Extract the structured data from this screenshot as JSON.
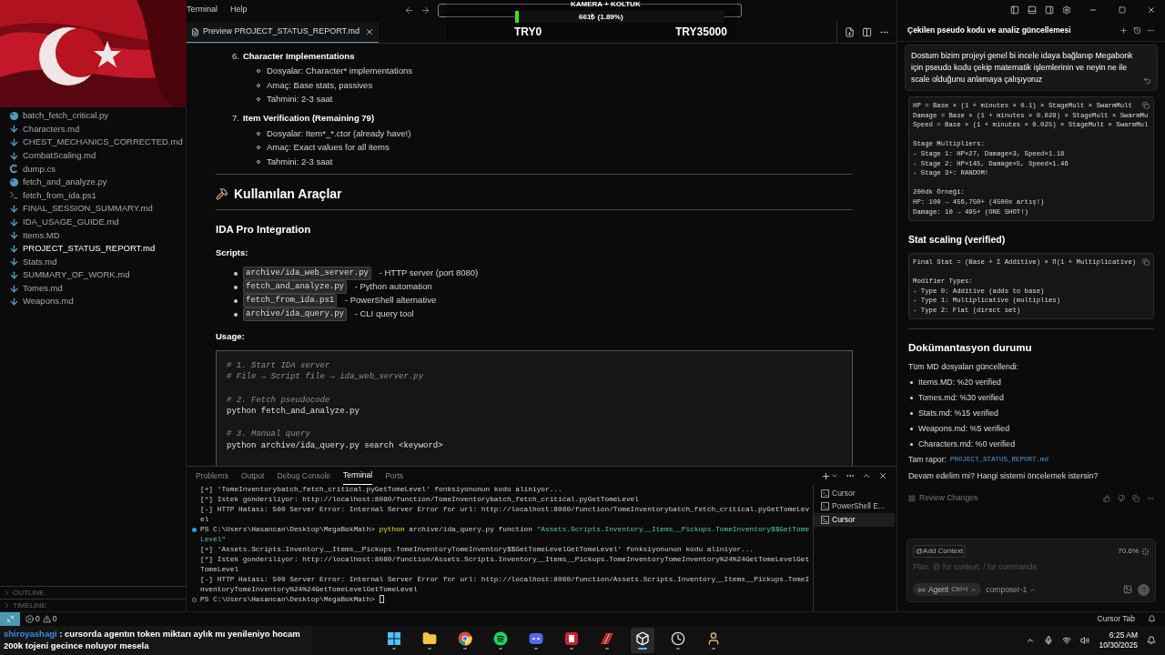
{
  "menu": [
    "Terminal",
    "Help"
  ],
  "stream_goal": {
    "title": "KAMERA + KOLTUK",
    "amount": "661₺ (1.89%)",
    "level": 0.0189,
    "min": "TRY0",
    "max": "TRY35000"
  },
  "explorer": {
    "files": [
      {
        "name": "batch_fetch_critical.py",
        "kind": "python",
        "selected": false
      },
      {
        "name": "Characters.md",
        "kind": "markdown",
        "selected": false
      },
      {
        "name": "CHEST_MECHANICS_CORRECTED.md",
        "kind": "markdown",
        "selected": false
      },
      {
        "name": "CombatScaling.md",
        "kind": "markdown",
        "selected": false
      },
      {
        "name": "dump.cs",
        "kind": "csharp",
        "selected": false
      },
      {
        "name": "fetch_and_analyze.py",
        "kind": "python",
        "selected": false
      },
      {
        "name": "fetch_from_ida.ps1",
        "kind": "powershell",
        "selected": false
      },
      {
        "name": "FINAL_SESSION_SUMMARY.md",
        "kind": "markdown",
        "selected": false
      },
      {
        "name": "IDA_USAGE_GUIDE.md",
        "kind": "markdown",
        "selected": false
      },
      {
        "name": "Items.MD",
        "kind": "markdown",
        "selected": false
      },
      {
        "name": "PROJECT_STATUS_REPORT.md",
        "kind": "markdown",
        "selected": true
      },
      {
        "name": "Stats.md",
        "kind": "markdown",
        "selected": false
      },
      {
        "name": "SUMMARY_OF_WORK.md",
        "kind": "markdown",
        "selected": false
      },
      {
        "name": "Tomes.md",
        "kind": "markdown",
        "selected": false
      },
      {
        "name": "Weapons.md",
        "kind": "markdown",
        "selected": false
      }
    ],
    "sections": [
      {
        "label": "OUTLINE",
        "expanded": false
      },
      {
        "label": "TIMELINE",
        "expanded": false
      }
    ]
  },
  "editor_tab": {
    "title": "Preview PROJECT_STATUS_REPORT.md"
  },
  "preview": {
    "steps": [
      {
        "number": "6.",
        "title": "Character Implementations",
        "bullets": [
          "Dosyalar: Character* implementations",
          "Amaç: Base stats, passives",
          "Tahmini: 2-3 saat"
        ]
      },
      {
        "number": "7.",
        "title": "Item Verification (Remaining 79)",
        "bullets": [
          "Dosyalar: Item*_*.ctor (already have!)",
          "Amaç: Exact values for all items",
          "Tahmini: 2-3 saat"
        ]
      }
    ],
    "heading": "Kullanılan Araçlar",
    "subheading": "IDA Pro Integration",
    "scripts_label": "Scripts:",
    "scripts": [
      {
        "code": "archive/ida_web_server.py",
        "desc": " - HTTP server (port 8080)"
      },
      {
        "code": "fetch_and_analyze.py",
        "desc": " - Python automation"
      },
      {
        "code": "fetch_from_ida.ps1",
        "desc": " - PowerShell alternative"
      },
      {
        "code": "archive/ida_query.py",
        "desc": " - CLI query tool"
      }
    ],
    "usage_label": "Usage:",
    "code_groups": [
      [
        {
          "kind": "comment",
          "text": "# 1. Start IDA server"
        },
        {
          "kind": "comment",
          "text": "# File → Script file → ida_web_server.py"
        }
      ],
      [
        {
          "kind": "comment",
          "text": "# 2. Fetch pseudocode"
        },
        {
          "kind": "code",
          "text": "python fetch_and_analyze.py"
        }
      ],
      [
        {
          "kind": "comment",
          "text": "# 3. Manual query"
        },
        {
          "kind": "code",
          "text": "python archive/ida_query.py search <keyword>"
        }
      ]
    ]
  },
  "terminal": {
    "tabs": [
      {
        "label": "Problems",
        "selected": false
      },
      {
        "label": "Output",
        "selected": false
      },
      {
        "label": "Debug Console",
        "selected": false
      },
      {
        "label": "Terminal",
        "selected": true
      },
      {
        "label": "Ports",
        "selected": false
      }
    ],
    "lines": [
      {
        "kind": "output",
        "text": "[+] 'TomeInventorybatch_fetch_critical.pyGetTomeLevel' fonksiyonunun kodu aliniyor..."
      },
      {
        "kind": "output",
        "text": "[*] Istek gonderiliyor: http://localhost:8080/function/TomeInventorybatch_fetch_critical.pyGetTomeLevel"
      },
      {
        "kind": "output",
        "text": "[-] HTTP Hatası: 500 Server Error: Internal Server Error for url: http://localhost:8080/function/TomeInventorybatch_fetch_critical.pyGetTomeLevel"
      },
      {
        "kind": "prompt",
        "finished": true,
        "prompt": "PS C:\\Users\\Hasancan\\Desktop\\MegaBokMath> ",
        "program": "python",
        "args": " archive/ida_query.py function ",
        "string": "\"Assets.Scripts.Inventory__Items__Pickups.TomeInventory$$GetTomeLevel\""
      },
      {
        "kind": "output",
        "text": "[+] 'Assets.Scripts.Inventory__Items__Pickups.TomeInventoryTomeInventory$$GetTomeLevelGetTomeLevel' fonksiyonunun kodu aliniyor..."
      },
      {
        "kind": "output",
        "text": "[*] Istek gonderiliyor: http://localhost:8080/function/Assets.Scripts.Inventory__Items__Pickups.TomeInventoryTomeInventory%24%24GetTomeLevelGetTomeLevel"
      },
      {
        "kind": "output",
        "text": "[-] HTTP Hatası: 500 Server Error: Internal Server Error for url: http://localhost:8080/function/Assets.Scripts.Inventory__Items__Pickups.TomeInventoryTomeInventory%24%24GetTomeLevelGetTomeLevel"
      },
      {
        "kind": "prompt",
        "finished": false,
        "prompt": "PS C:\\Users\\Hasancan\\Desktop\\MegaBokMath> "
      }
    ],
    "sessions": [
      {
        "name": "Cursor",
        "selected": false
      },
      {
        "name": "PowerShell E...",
        "selected": false
      },
      {
        "name": "Cursor",
        "selected": true
      }
    ]
  },
  "chat_panel": {
    "title": "Çekilen pseudo kodu ve analiz güncellemesi",
    "user_message": "Dostum bizim projeyi genel bi incele idaya bağlanıp Megabonk için pseudo kodu çekip matematik işlemlerinin ve neyin ne ile scale olduğunu anlamaya çalışıyoruz",
    "code_block_1": [
      [
        "HP = Base × (1 + minutes × 0.1) × StageMult × SwarmMult",
        "Damage = Base × (1 + minutes × 0.028) × StageMult × SwarmMu",
        "Speed = Base × (1 + minutes × 0.025) × StageMult × SwarmMul"
      ],
      [
        "Stage Multipliers:",
        "- Stage 1: HP×27, Damage×3, Speed×1.18",
        "- Stage 2: HP×145, Damage×5, Speed×1.46",
        "- Stage 3+: RANDOM!"
      ],
      [
        "200dk Örneği:",
        "HP: 100 → 456,750+ (4500x artış!)",
        "Damage: 10 → 495+ (ONE SHOT!)"
      ]
    ],
    "heading_1": "Stat scaling (verified)",
    "code_block_2": [
      [
        "Final Stat = (Base + Σ Additive) × Π(1 + Multiplicative)"
      ],
      [
        "Modifier Types:",
        "- Type 0: Additive (adds to base)",
        "- Type 1: Multiplicative (multiplies)",
        "- Type 2: Flat (direct set)"
      ]
    ],
    "heading_2": "Dokümantasyon durumu",
    "paragraph": "Tüm MD dosyaları güncellendi:",
    "bullets": [
      "Items.MD: %20 verified",
      "Tomes.md: %30 verified",
      "Stats.md: %15 verified",
      "Weapons.md: %5 verified",
      "Characters.md: %0 verified"
    ],
    "report_label": "Tam rapor:",
    "report_link": "PROJECT_STATUS_REPORT.md",
    "question": "Devam edelim mi? Hangi sistemi öncelemek istersin?",
    "review": "Review Changes",
    "input": {
      "context_chip": "@Add Context",
      "usage": "70.6%",
      "placeholder": "Plan, @ for context, / for commands",
      "mode": "Agent",
      "shortcut": "Ctrl+I",
      "model": "composer-1"
    }
  },
  "status_bar": {
    "errors": "0",
    "warnings": "0",
    "right": "Cursor Tab"
  },
  "stream_chat": {
    "user": "shiroyashagi",
    "message": " : cursorda agentın token miktarı aylık mı yenileniyo hocam 200k tojeni gecince noluyor mesela"
  },
  "taskbar": {
    "apps": [
      {
        "kind": "start",
        "active": false
      },
      {
        "kind": "folder",
        "active": false
      },
      {
        "kind": "browser",
        "active": false
      },
      {
        "kind": "music",
        "active": false
      },
      {
        "kind": "chat",
        "active": false
      },
      {
        "kind": "redapp",
        "active": false
      },
      {
        "kind": "game",
        "active": false
      },
      {
        "kind": "editor",
        "active": true
      },
      {
        "kind": "clock",
        "active": false
      },
      {
        "kind": "figure",
        "active": false
      }
    ],
    "time": "6:25 AM",
    "date": "10/30/2025"
  }
}
